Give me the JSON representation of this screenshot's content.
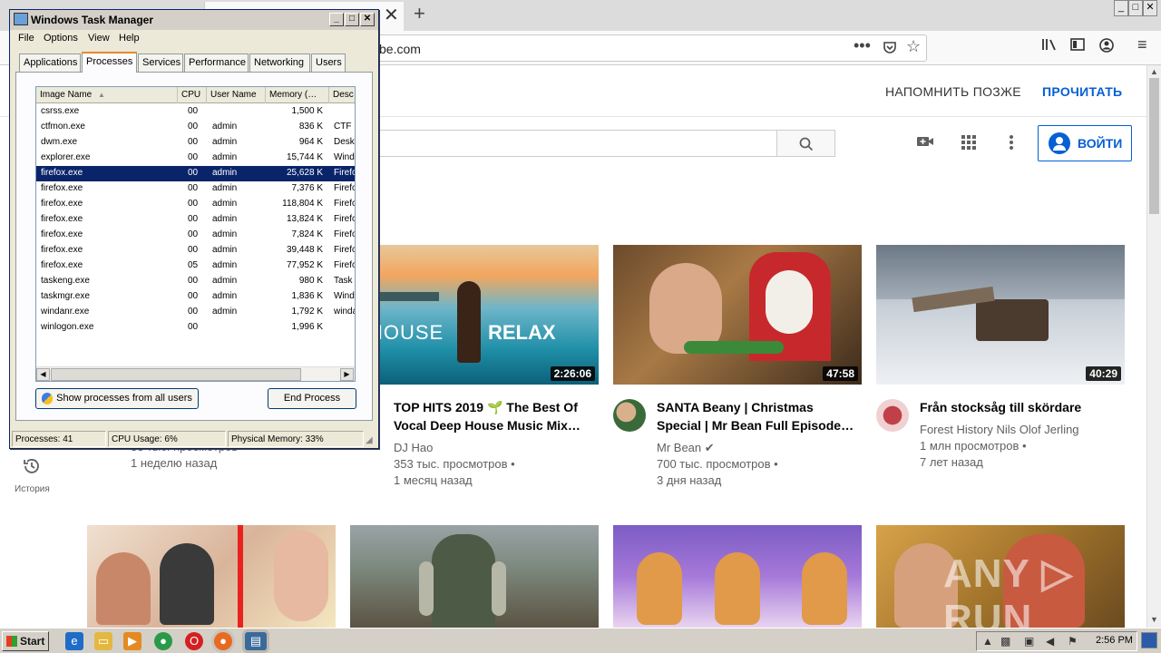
{
  "browser": {
    "tab_close": "✕",
    "tab_new": "+",
    "url": "be.com",
    "window_controls": [
      "_",
      "□",
      "✕"
    ]
  },
  "youtube": {
    "promo": {
      "later": "НАПОМНИТЬ ПОЗЖЕ",
      "read": "ПРОЧИТАТЬ"
    },
    "signin": "ВОЙТИ",
    "sidebar": {
      "history": "История"
    },
    "videos": [
      {
        "title_line1": "TOP HITS 2019 🌱 The Best Of",
        "title_line2": "Vocal Deep House Music Mix…",
        "channel": "DJ Hao",
        "views": "353 тыс. просмотров •",
        "age": "1 месяц назад",
        "duration": "2:26:06",
        "thumb_text_left": "HOUSE",
        "thumb_text_right": "RELAX"
      },
      {
        "title_line1": "SANTA Beany | Christmas",
        "title_line2": "Special | Mr Bean Full Episode…",
        "channel": "Mr Bean ✔",
        "views": "700 тыс. просмотров •",
        "age": "3 дня назад",
        "duration": "47:58"
      },
      {
        "title_line1": "Från stocksåg till skördare",
        "channel": "Forest History Nils Olof Jerling",
        "views": "1 млн просмотров •",
        "age": "7 лет назад",
        "duration": "40:29"
      }
    ],
    "partial_left_meta": {
      "views": "33 тыс. просмотров",
      "age": "1 неделю назад"
    },
    "watermark": "ANY ▷ RUN"
  },
  "task_manager": {
    "title": "Windows Task Manager",
    "menu": [
      "File",
      "Options",
      "View",
      "Help"
    ],
    "tabs": [
      "Applications",
      "Processes",
      "Services",
      "Performance",
      "Networking",
      "Users"
    ],
    "active_tab": "Processes",
    "columns": [
      "Image Name",
      "CPU",
      "User Name",
      "Memory (…",
      "Desc"
    ],
    "processes": [
      [
        "csrss.exe",
        "00",
        "",
        "1,500 K",
        ""
      ],
      [
        "ctfmon.exe",
        "00",
        "admin",
        "836 K",
        "CTF I"
      ],
      [
        "dwm.exe",
        "00",
        "admin",
        "964 K",
        "Deskt"
      ],
      [
        "explorer.exe",
        "00",
        "admin",
        "15,744 K",
        "Wind"
      ],
      [
        "firefox.exe",
        "00",
        "admin",
        "25,628 K",
        "Firefo"
      ],
      [
        "firefox.exe",
        "00",
        "admin",
        "7,376 K",
        "Firefo"
      ],
      [
        "firefox.exe",
        "00",
        "admin",
        "118,804 K",
        "Firefo"
      ],
      [
        "firefox.exe",
        "00",
        "admin",
        "13,824 K",
        "Firefo"
      ],
      [
        "firefox.exe",
        "00",
        "admin",
        "7,824 K",
        "Firefo"
      ],
      [
        "firefox.exe",
        "00",
        "admin",
        "39,448 K",
        "Firefo"
      ],
      [
        "firefox.exe",
        "05",
        "admin",
        "77,952 K",
        "Firefo"
      ],
      [
        "taskeng.exe",
        "00",
        "admin",
        "980 K",
        "Task"
      ],
      [
        "taskmgr.exe",
        "00",
        "admin",
        "1,836 K",
        "Wind"
      ],
      [
        "windanr.exe",
        "00",
        "admin",
        "1,792 K",
        "winda"
      ],
      [
        "winlogon.exe",
        "00",
        "",
        "1,996 K",
        ""
      ]
    ],
    "selected_row": 4,
    "show_all_button": "Show processes from all users",
    "end_process_button": "End Process",
    "status": {
      "processes": "Processes: 41",
      "cpu": "CPU Usage: 6%",
      "memory": "Physical Memory: 33%"
    }
  },
  "taskbar": {
    "start": "Start",
    "clock": "2:56 PM"
  },
  "colors": {
    "youtube_blue": "#065fd4",
    "selection": "#0a246a",
    "taskbar": "#d4d0c8"
  }
}
